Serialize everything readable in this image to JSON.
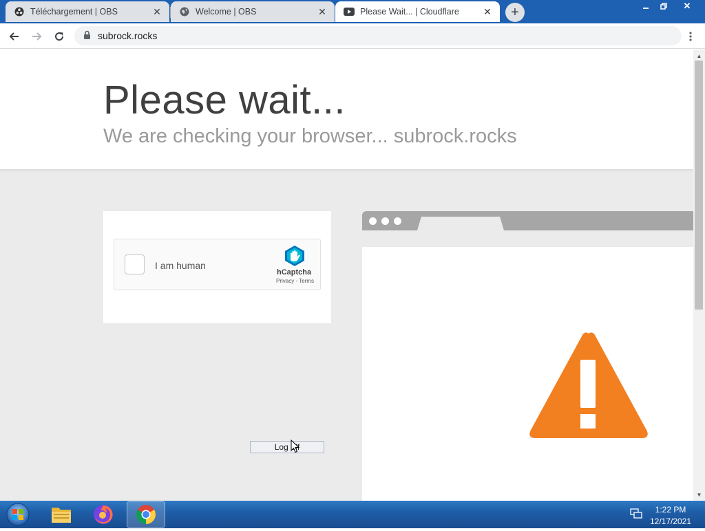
{
  "browser": {
    "tabs": [
      {
        "title": "Téléchargement | OBS",
        "icon": "obs-icon",
        "active": false
      },
      {
        "title": "Welcome | OBS",
        "icon": "globe-icon",
        "active": false
      },
      {
        "title": "Please Wait... | Cloudflare",
        "icon": "youtube-icon",
        "active": true
      }
    ],
    "new_tab_label": "+",
    "close_glyph": "✕",
    "address": "subrock.rocks",
    "window_controls": [
      "minimize",
      "restore",
      "close"
    ]
  },
  "page": {
    "title": "Please wait...",
    "subtitle": "We are checking your browser... subrock.rocks",
    "captcha": {
      "checkbox_label": "I am human",
      "brand": "hCaptcha",
      "links": "Privacy - Terms"
    },
    "log_off_label": "Log off",
    "warning_color": "#f38020"
  },
  "taskbar": {
    "apps": [
      "file-explorer-icon",
      "firefox-icon",
      "chrome-icon"
    ],
    "time": "1:22 PM",
    "date": "12/17/2021"
  }
}
